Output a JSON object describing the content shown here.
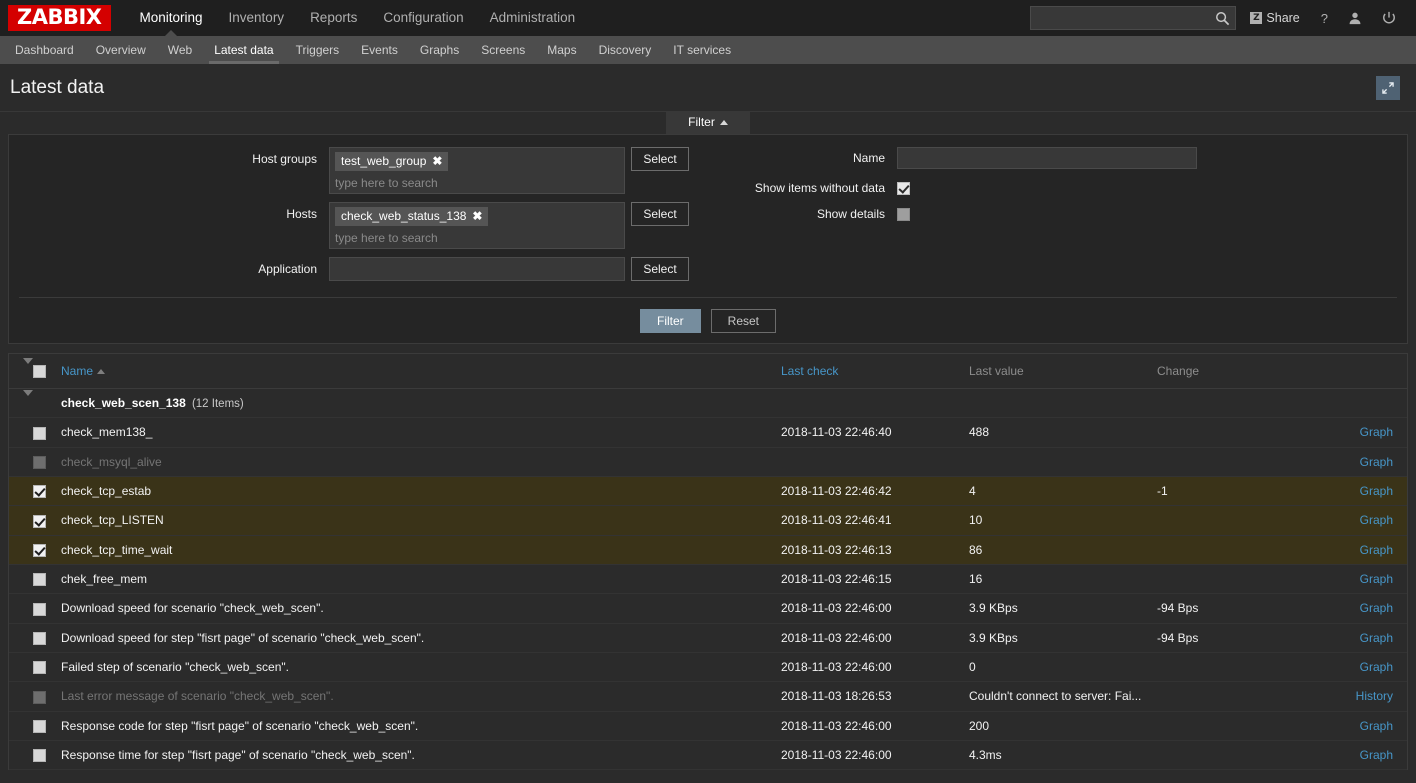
{
  "brand": {
    "logo": "ZABBIX"
  },
  "topnav": {
    "items": [
      {
        "label": "Monitoring",
        "active": true
      },
      {
        "label": "Inventory",
        "active": false
      },
      {
        "label": "Reports",
        "active": false
      },
      {
        "label": "Configuration",
        "active": false
      },
      {
        "label": "Administration",
        "active": false
      }
    ],
    "search": {
      "value": "",
      "placeholder": ""
    },
    "share_label": "Share",
    "share_badge": "Z",
    "help_icon": "?",
    "user_icon": "user-icon",
    "power_icon": "power-icon"
  },
  "subnav": {
    "items": [
      {
        "label": "Dashboard",
        "active": false
      },
      {
        "label": "Overview",
        "active": false
      },
      {
        "label": "Web",
        "active": false
      },
      {
        "label": "Latest data",
        "active": true
      },
      {
        "label": "Triggers",
        "active": false
      },
      {
        "label": "Events",
        "active": false
      },
      {
        "label": "Graphs",
        "active": false
      },
      {
        "label": "Screens",
        "active": false
      },
      {
        "label": "Maps",
        "active": false
      },
      {
        "label": "Discovery",
        "active": false
      },
      {
        "label": "IT services",
        "active": false
      }
    ]
  },
  "page": {
    "title": "Latest data",
    "kiosk_icon": "fullscreen-expand-icon"
  },
  "filter": {
    "tab_label": "Filter",
    "host_groups": {
      "label": "Host groups",
      "pills": [
        "test_web_group"
      ],
      "placeholder": "type here to search",
      "select_label": "Select"
    },
    "hosts": {
      "label": "Hosts",
      "pills": [
        "check_web_status_138"
      ],
      "placeholder": "type here to search",
      "select_label": "Select"
    },
    "application": {
      "label": "Application",
      "value": "",
      "placeholder": "",
      "select_label": "Select"
    },
    "name": {
      "label": "Name",
      "value": "",
      "placeholder": ""
    },
    "show_without_data": {
      "label": "Show items without data",
      "checked": true
    },
    "show_details": {
      "label": "Show details",
      "checked": false
    },
    "filter_button": "Filter",
    "reset_button": "Reset"
  },
  "table": {
    "headers": {
      "name": "Name",
      "last_check": "Last check",
      "last_value": "Last value",
      "change": "Change"
    },
    "sort": "asc",
    "group": {
      "name": "check_web_scen_138",
      "count": "(12 Items)"
    },
    "rows": [
      {
        "checked": false,
        "disabled": false,
        "name": "check_mem138_",
        "last_check": "2018-11-03 22:46:40",
        "last_value": "488",
        "change": "",
        "action": "Graph"
      },
      {
        "checked": false,
        "disabled": true,
        "name": "check_msyql_alive",
        "last_check": "",
        "last_value": "",
        "change": "",
        "action": "Graph"
      },
      {
        "checked": true,
        "disabled": false,
        "name": "check_tcp_estab",
        "last_check": "2018-11-03 22:46:42",
        "last_value": "4",
        "change": "-1",
        "action": "Graph"
      },
      {
        "checked": true,
        "disabled": false,
        "name": "check_tcp_LISTEN",
        "last_check": "2018-11-03 22:46:41",
        "last_value": "10",
        "change": "",
        "action": "Graph"
      },
      {
        "checked": true,
        "disabled": false,
        "name": "check_tcp_time_wait",
        "last_check": "2018-11-03 22:46:13",
        "last_value": "86",
        "change": "",
        "action": "Graph"
      },
      {
        "checked": false,
        "disabled": false,
        "name": "chek_free_mem",
        "last_check": "2018-11-03 22:46:15",
        "last_value": "16",
        "change": "",
        "action": "Graph"
      },
      {
        "checked": false,
        "disabled": false,
        "name": "Download speed for scenario \"check_web_scen\".",
        "last_check": "2018-11-03 22:46:00",
        "last_value": "3.9 KBps",
        "change": "-94 Bps",
        "action": "Graph"
      },
      {
        "checked": false,
        "disabled": false,
        "name": "Download speed for step \"fisrt page\" of scenario \"check_web_scen\".",
        "last_check": "2018-11-03 22:46:00",
        "last_value": "3.9 KBps",
        "change": "-94 Bps",
        "action": "Graph"
      },
      {
        "checked": false,
        "disabled": false,
        "name": "Failed step of scenario \"check_web_scen\".",
        "last_check": "2018-11-03 22:46:00",
        "last_value": "0",
        "change": "",
        "action": "Graph"
      },
      {
        "checked": false,
        "disabled": true,
        "name": "Last error message of scenario \"check_web_scen\".",
        "last_check": "2018-11-03 18:26:53",
        "last_value": "Couldn't connect to server: Fai...",
        "change": "",
        "action": "History"
      },
      {
        "checked": false,
        "disabled": false,
        "name": "Response code for step \"fisrt page\" of scenario \"check_web_scen\".",
        "last_check": "2018-11-03 22:46:00",
        "last_value": "200",
        "change": "",
        "action": "Graph"
      },
      {
        "checked": false,
        "disabled": false,
        "name": "Response time for step \"fisrt page\" of scenario \"check_web_scen\".",
        "last_check": "2018-11-03 22:46:00",
        "last_value": "4.3ms",
        "change": "",
        "action": "Graph"
      }
    ]
  },
  "colors": {
    "brand_red": "#d40000",
    "link_blue": "#4796c8",
    "selected_row": "#3a3318",
    "accent_button": "#768d9e"
  }
}
